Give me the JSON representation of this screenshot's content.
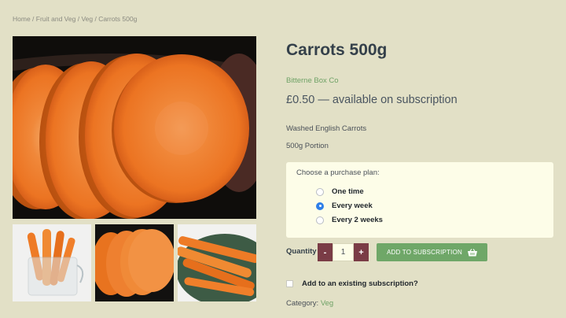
{
  "breadcrumb": {
    "items": [
      "Home",
      "Fruit and Veg",
      "Veg",
      "Carrots 500g"
    ],
    "separator": " / "
  },
  "product": {
    "title": "Carrots 500g",
    "brand": "Bitterne Box Co",
    "price": "£0.50",
    "price_suffix": " — available on subscription",
    "desc_line1": "Washed English Carrots",
    "desc_line2": "500g Portion"
  },
  "plan": {
    "heading": "Choose a purchase plan:",
    "options": [
      {
        "label": "One time",
        "selected": false
      },
      {
        "label": "Every week",
        "selected": true
      },
      {
        "label": "Every 2 weeks",
        "selected": false
      }
    ]
  },
  "quantity": {
    "label": "Quantity",
    "minus": "-",
    "plus": "+",
    "value": "1"
  },
  "add_button": {
    "label": "ADD TO SUBSCRIPTION",
    "icon": "basket-icon"
  },
  "existing_subscription": {
    "label": "Add to an existing subscription?",
    "checked": false
  },
  "category": {
    "prefix": "Category: ",
    "value": "Veg"
  },
  "colors": {
    "background": "#e2e0c6",
    "accent_green": "#6fa768",
    "qty_button": "#7a3c46",
    "radio_selected": "#2f7fe8"
  }
}
